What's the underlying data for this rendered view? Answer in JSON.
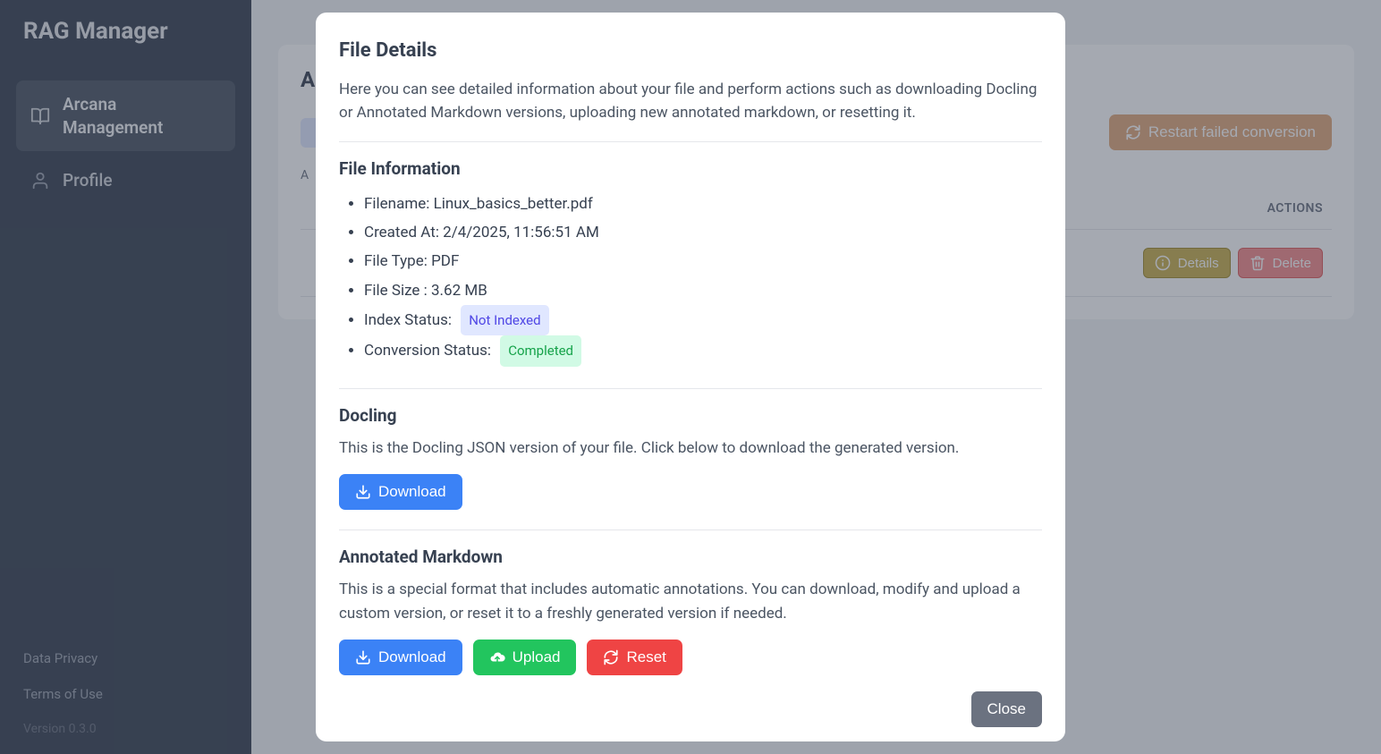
{
  "sidebar": {
    "title": "RAG Manager",
    "items": [
      {
        "label": "Arcana Management"
      },
      {
        "label": "Profile"
      }
    ],
    "footer": {
      "privacy": "Data Privacy",
      "terms": "Terms of Use",
      "version": "Version 0.3.0"
    }
  },
  "page": {
    "title_prefix": "A",
    "restart_label": "Restart failed conversion",
    "filters_label": "A",
    "actions_col": "ACTIONS",
    "details_btn": "Details",
    "delete_btn": "Delete"
  },
  "modal": {
    "title": "File Details",
    "intro": "Here you can see detailed information about your file and perform actions such as downloading Docling or Annotated Markdown versions, uploading new annotated markdown, or resetting it.",
    "file_info": {
      "heading": "File Information",
      "filename_label": "Filename: ",
      "filename": "Linux_basics_better.pdf",
      "created_label": "Created At: ",
      "created": "2/4/2025, 11:56:51 AM",
      "type_label": "File Type: ",
      "type": "PDF",
      "size_label": "File Size : ",
      "size": "3.62 MB",
      "index_label": "Index Status: ",
      "index_status": "Not Indexed",
      "conv_label": "Conversion Status: ",
      "conv_status": "Completed"
    },
    "docling": {
      "heading": "Docling",
      "text": "This is the Docling JSON version of your file. Click below to download the generated version.",
      "download": "Download"
    },
    "annotated": {
      "heading": "Annotated Markdown",
      "text": "This is a special format that includes automatic annotations. You can download, modify and upload a custom version, or reset it to a freshly generated version if needed.",
      "download": "Download",
      "upload": "Upload",
      "reset": "Reset"
    },
    "close": "Close"
  }
}
